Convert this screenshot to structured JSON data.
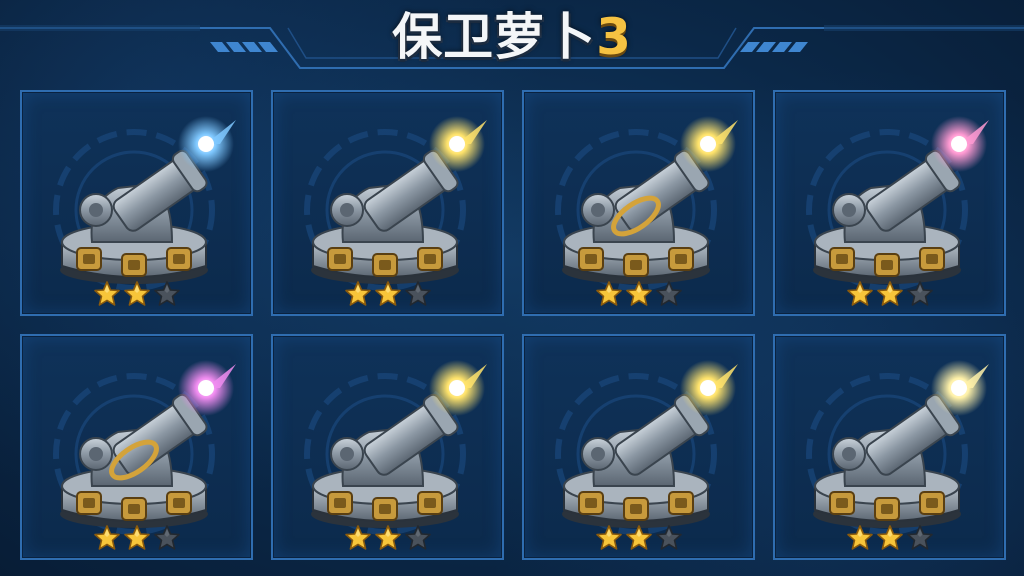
{
  "header": {
    "title_text": "保卫萝卜",
    "title_number": "3"
  },
  "colors": {
    "accent_gold": "#f5c242",
    "frame_blue": "#2f6db0",
    "background": "#0b2848"
  },
  "towers": [
    {
      "icon": "cannon-tower-icon",
      "glow": "blue",
      "glow_color": "#7fc8ff",
      "has_gold_ring": false,
      "stars_filled": 2,
      "stars_total": 3
    },
    {
      "icon": "cannon-tower-icon",
      "glow": "yellow",
      "glow_color": "#ffe36b",
      "has_gold_ring": false,
      "stars_filled": 2,
      "stars_total": 3
    },
    {
      "icon": "cannon-tower-icon",
      "glow": "yellow",
      "glow_color": "#ffe36b",
      "has_gold_ring": true,
      "stars_filled": 2,
      "stars_total": 3
    },
    {
      "icon": "cannon-tower-icon",
      "glow": "pink",
      "glow_color": "#ff9ad2",
      "has_gold_ring": false,
      "stars_filled": 2,
      "stars_total": 3
    },
    {
      "icon": "cannon-tower-icon",
      "glow": "magenta",
      "glow_color": "#f08cf0",
      "has_gold_ring": true,
      "stars_filled": 2,
      "stars_total": 3
    },
    {
      "icon": "cannon-tower-icon",
      "glow": "yellow",
      "glow_color": "#ffe36b",
      "has_gold_ring": false,
      "stars_filled": 2,
      "stars_total": 3
    },
    {
      "icon": "cannon-tower-icon",
      "glow": "yellow",
      "glow_color": "#ffe36b",
      "has_gold_ring": false,
      "stars_filled": 2,
      "stars_total": 3
    },
    {
      "icon": "cannon-tower-icon",
      "glow": "pale-yellow",
      "glow_color": "#fff1a8",
      "has_gold_ring": false,
      "stars_filled": 2,
      "stars_total": 3
    }
  ]
}
